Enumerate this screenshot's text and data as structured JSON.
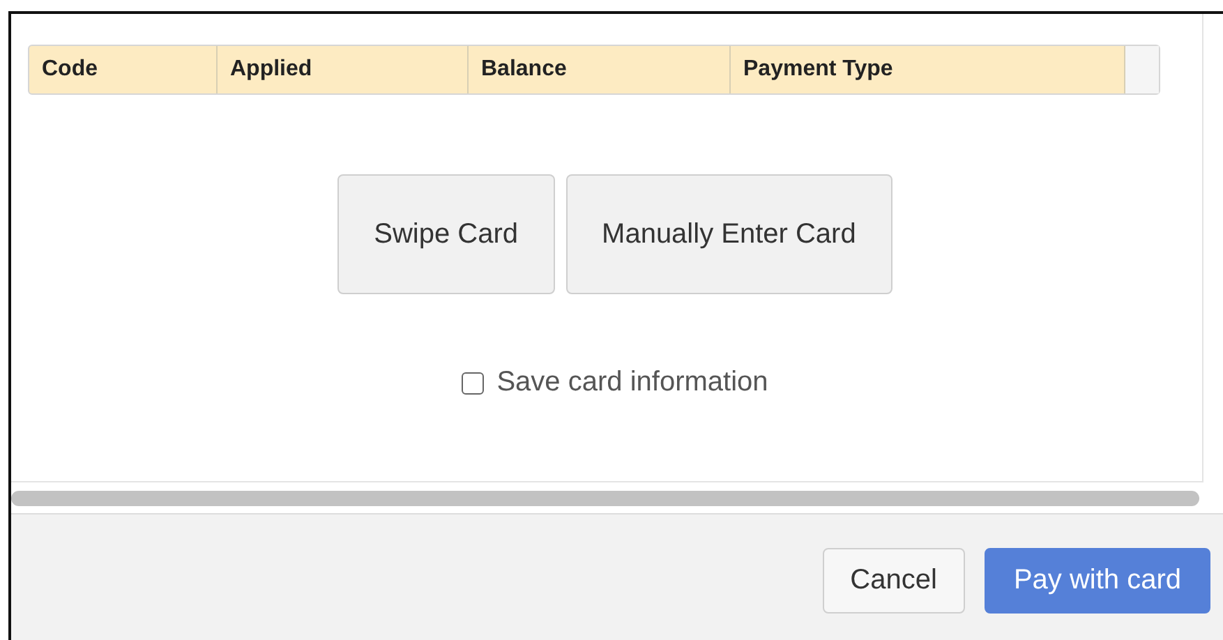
{
  "table": {
    "columns": [
      "Code",
      "Applied",
      "Balance",
      "Payment Type"
    ]
  },
  "card_buttons": [
    "Swipe Card",
    "Manually Enter Card"
  ],
  "save_card": {
    "label": "Save card information",
    "checked": false
  },
  "footer": {
    "buttons": [
      {
        "label": "Cancel",
        "kind": "secondary"
      },
      {
        "label": "Pay with card",
        "kind": "primary"
      }
    ]
  }
}
